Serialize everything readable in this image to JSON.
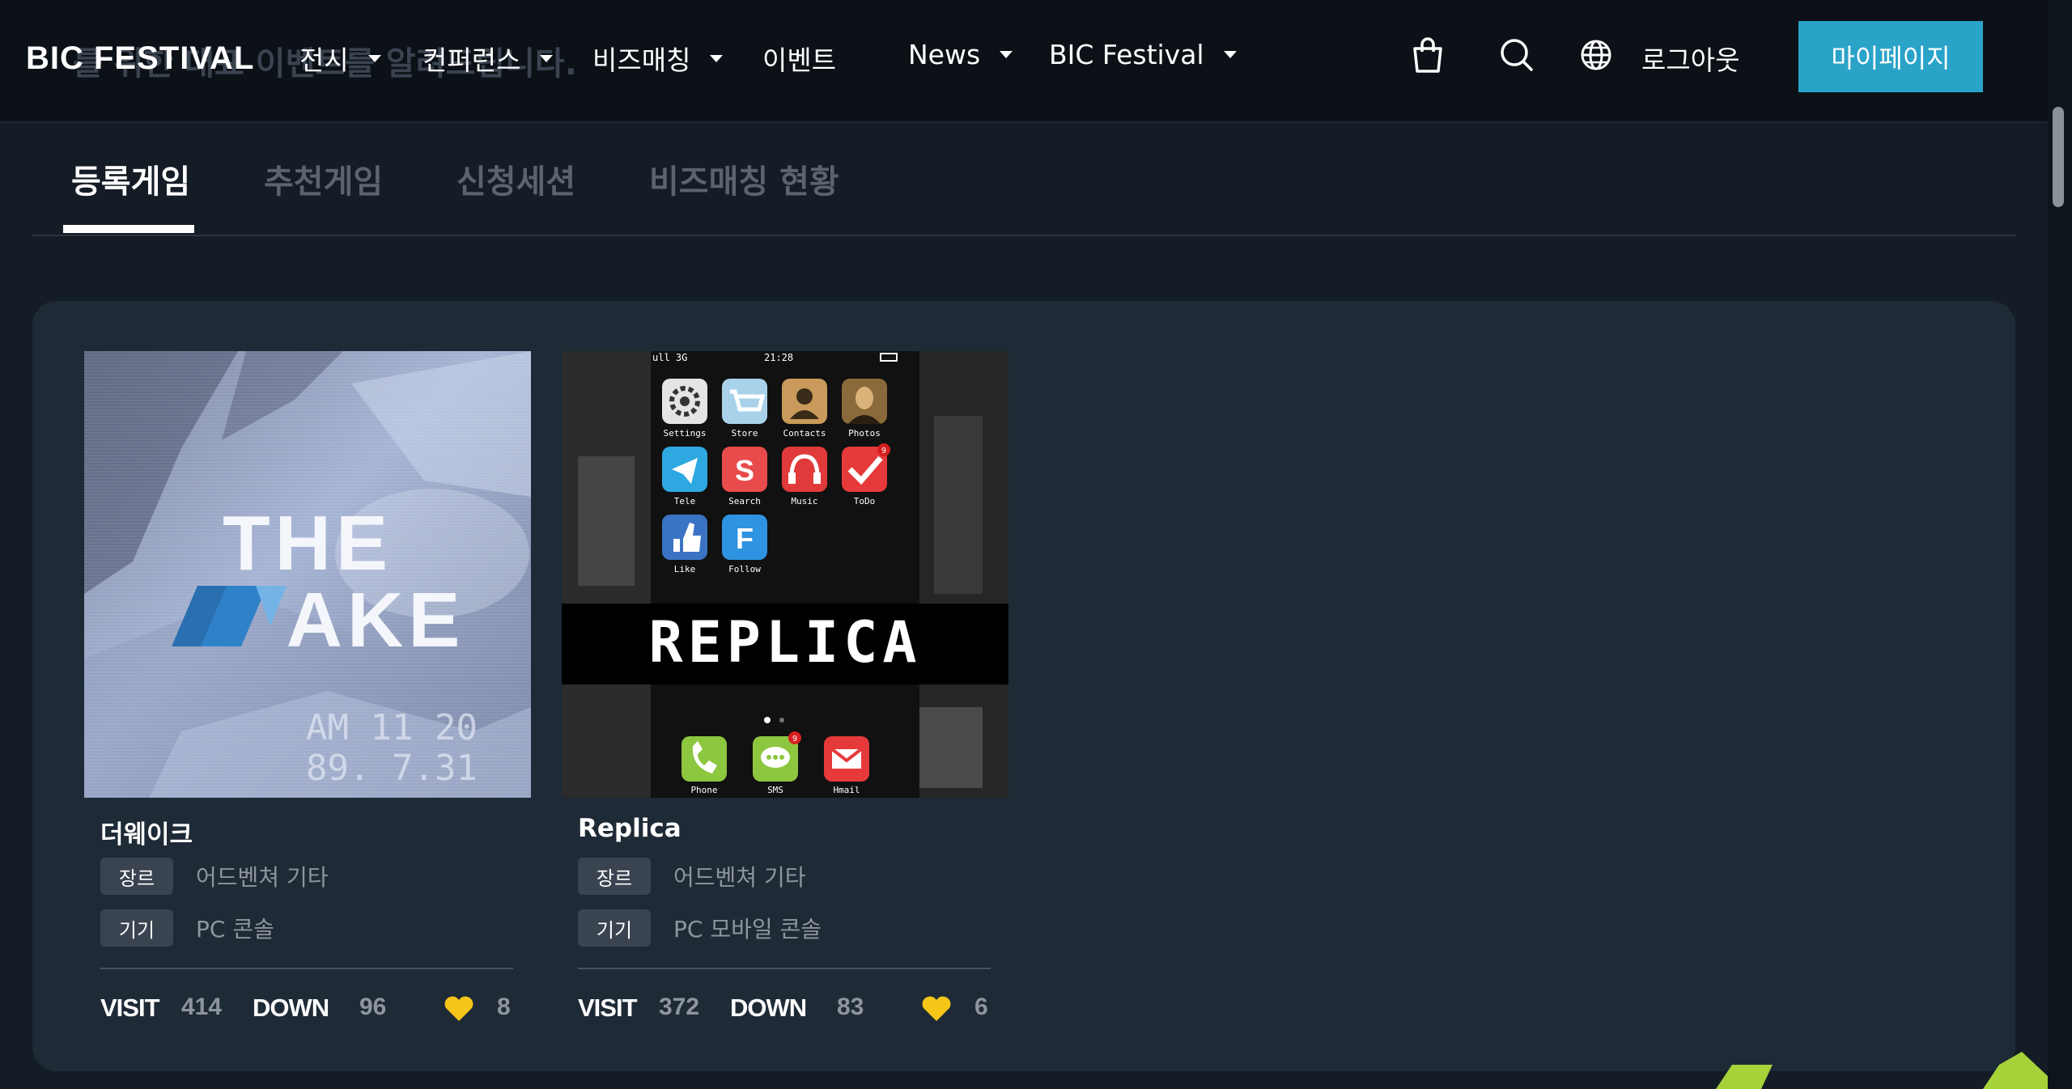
{
  "header": {
    "logo": "BIC FESTIVAL",
    "ghost_text": "를 위한 대표 이벤트를 알려드립니다.",
    "nav": [
      {
        "label": "전시",
        "dropdown": true
      },
      {
        "label": "컨퍼런스",
        "dropdown": true
      },
      {
        "label": "비즈매칭",
        "dropdown": true
      },
      {
        "label": "이벤트",
        "dropdown": false
      },
      {
        "label": "News",
        "dropdown": true
      },
      {
        "label": "BIC Festival",
        "dropdown": true
      }
    ],
    "icons": [
      "shopping-bag-icon",
      "search-icon",
      "globe-icon"
    ],
    "logout_label": "로그아웃",
    "mypage_label": "마이페이지",
    "accent_color": "#2aa3c9"
  },
  "tabs": [
    {
      "label": "등록게임",
      "active": true
    },
    {
      "label": "추천게임",
      "active": false
    },
    {
      "label": "신청세션",
      "active": false
    },
    {
      "label": "비즈매칭 현황",
      "active": false
    }
  ],
  "cards": [
    {
      "title": "더웨이크",
      "thumb": {
        "line1": "THE",
        "line2": "AKE",
        "stamp1": "AM 11 20",
        "stamp2": "89. 7.31"
      },
      "genre_label": "장르",
      "genre": "어드벤쳐 기타",
      "device_label": "기기",
      "device": "PC 콘솔",
      "visit_label": "VISIT",
      "visit": "414",
      "down_label": "DOWN",
      "down": "96",
      "likes": "8"
    },
    {
      "title": "Replica",
      "thumb": {
        "status_signal": "ull 3G",
        "status_time": "21:28",
        "logo": "REPLICA",
        "apps": [
          "Settings",
          "Store",
          "Contacts",
          "Photos",
          "Tele",
          "Search",
          "Music",
          "ToDo",
          "Like",
          "Follow"
        ],
        "dock": [
          "Phone",
          "SMS",
          "Hmail"
        ],
        "todo_badge": "9",
        "sms_badge": "9"
      },
      "genre_label": "장르",
      "genre": "어드벤쳐 기타",
      "device_label": "기기",
      "device": "PC 모바일 콘솔",
      "visit_label": "VISIT",
      "visit": "372",
      "down_label": "DOWN",
      "down": "83",
      "likes": "6"
    }
  ],
  "colors": {
    "heart": "#f5c518",
    "deco": "#a6d23a"
  }
}
